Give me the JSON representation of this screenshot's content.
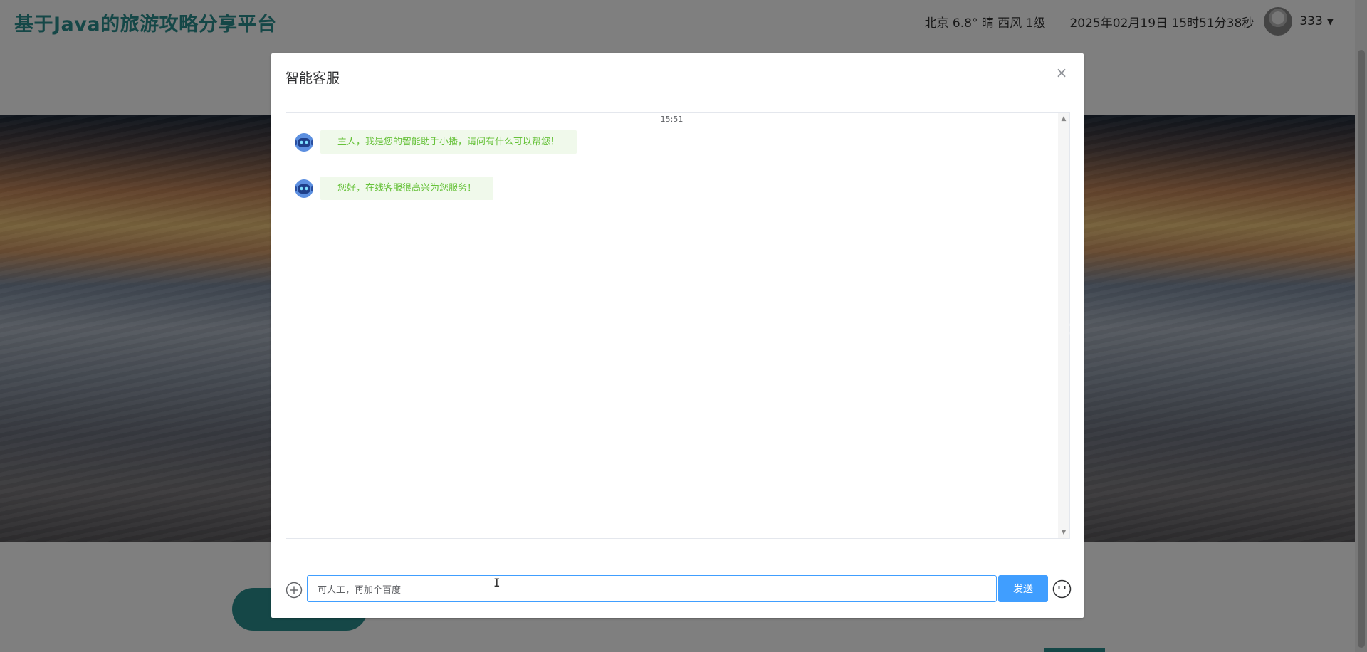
{
  "header": {
    "site_title": "基于Java的旅游攻略分享平台",
    "weather": "北京  6.8°  晴  西风  1级",
    "datetime": "2025年02月19日 15时51分38秒",
    "username": "333",
    "caret": "▼"
  },
  "banner": {
    "next_arrow": "›"
  },
  "dialog": {
    "title": "智能客服",
    "close_glyph": "×",
    "chat": {
      "time": "15:51",
      "messages": [
        {
          "sender": "bot",
          "text": "主人，我是您的智能助手小播，请问有什么可以帮您！"
        },
        {
          "sender": "bot",
          "text": "您好，在线客服很高兴为您服务！"
        }
      ],
      "scroll_up": "▲",
      "scroll_down": "▼"
    },
    "input": {
      "value": "可人工，再加个百度",
      "send_label": "发送"
    }
  },
  "colors": {
    "brand": "#2b8f8f",
    "accent": "#409eff",
    "bubble_bg": "#f0f9eb",
    "bubble_text": "#67c23a"
  },
  "icons": {
    "close": "close-icon",
    "bot": "robot-avatar-icon",
    "plus": "plus-circle-icon",
    "emoji": "emoji-icon"
  }
}
